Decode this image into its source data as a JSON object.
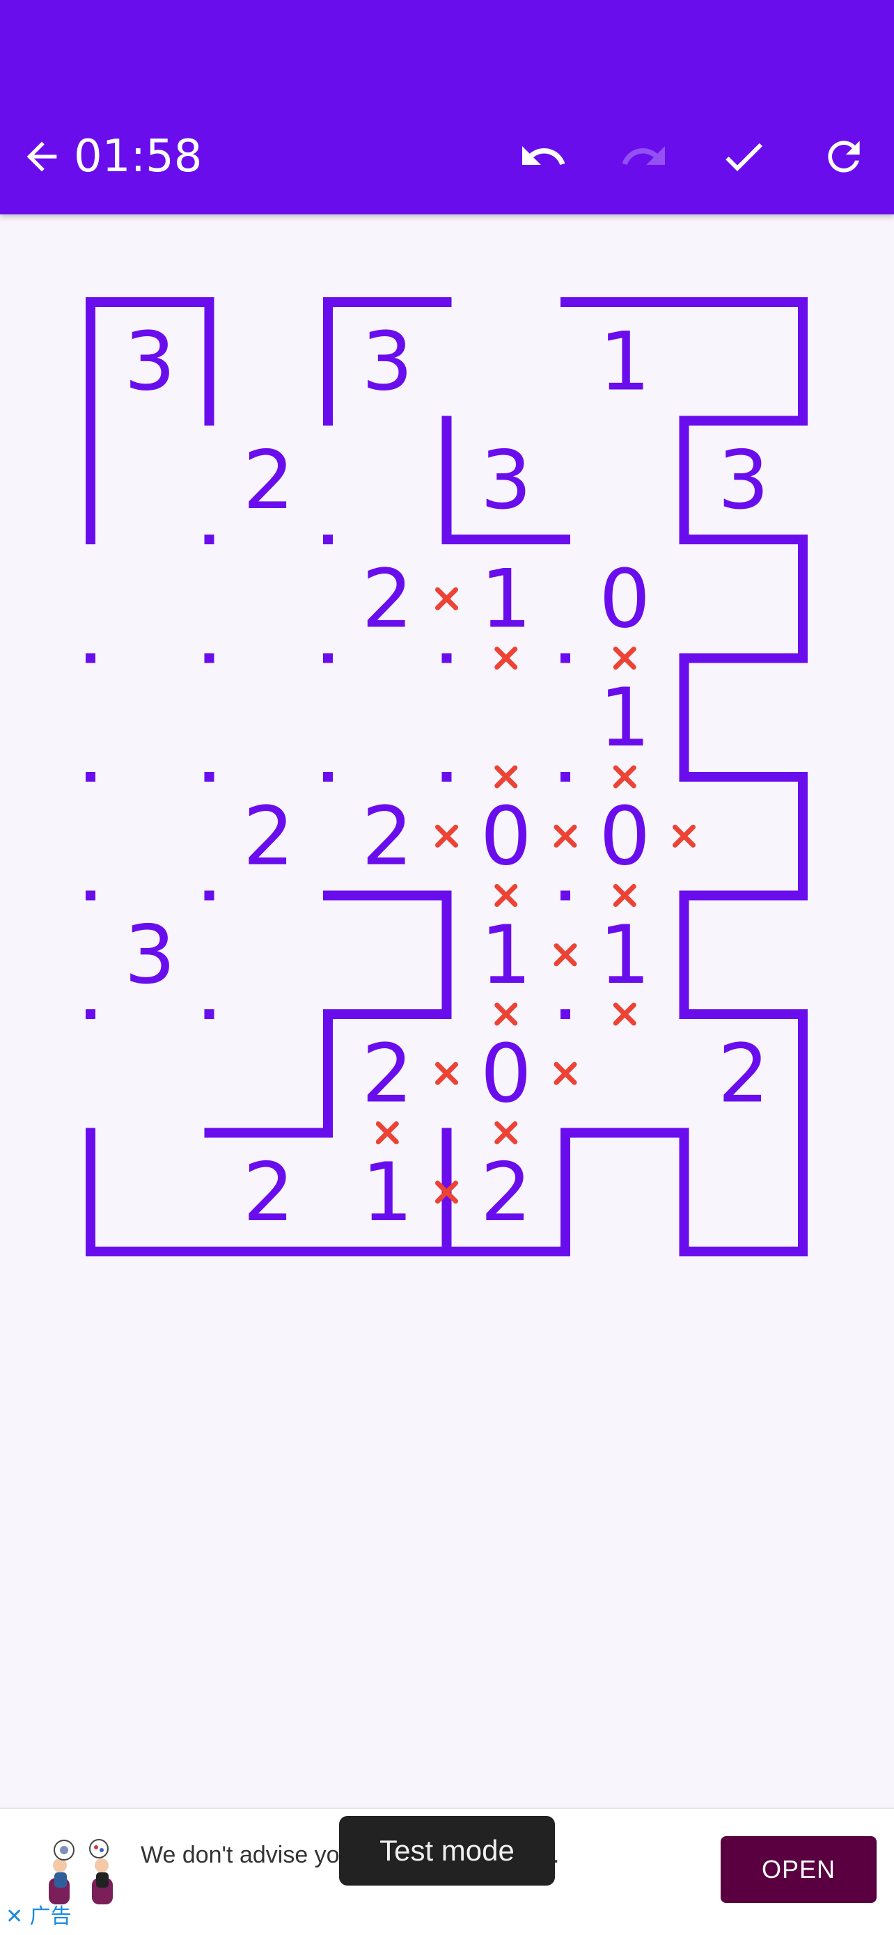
{
  "header": {
    "timer": "01:58",
    "icons": {
      "back": "arrow-back-icon",
      "undo": "undo-icon",
      "redo": "redo-icon",
      "check": "check-icon",
      "restart": "restart-icon"
    },
    "background_color": "#6a0ded"
  },
  "puzzle": {
    "rows": 8,
    "cols": 6,
    "line_color": "#6a0ded",
    "number_color": "#6a0ded",
    "cross_color": "#ec4334",
    "clues": [
      {
        "row": 0,
        "col": 0,
        "text": "3"
      },
      {
        "row": 0,
        "col": 2,
        "text": "3"
      },
      {
        "row": 0,
        "col": 4,
        "text": "1"
      },
      {
        "row": 1,
        "col": 1,
        "text": "2"
      },
      {
        "row": 1,
        "col": 3,
        "text": "3"
      },
      {
        "row": 1,
        "col": 5,
        "text": "3"
      },
      {
        "row": 2,
        "col": 2,
        "text": "2"
      },
      {
        "row": 2,
        "col": 3,
        "text": "1"
      },
      {
        "row": 2,
        "col": 4,
        "text": "0"
      },
      {
        "row": 3,
        "col": 4,
        "text": "1"
      },
      {
        "row": 4,
        "col": 1,
        "text": "2"
      },
      {
        "row": 4,
        "col": 2,
        "text": "2"
      },
      {
        "row": 4,
        "col": 3,
        "text": "0"
      },
      {
        "row": 4,
        "col": 4,
        "text": "0"
      },
      {
        "row": 5,
        "col": 0,
        "text": "3"
      },
      {
        "row": 5,
        "col": 3,
        "text": "1"
      },
      {
        "row": 5,
        "col": 4,
        "text": "1"
      },
      {
        "row": 6,
        "col": 2,
        "text": "2"
      },
      {
        "row": 6,
        "col": 3,
        "text": "0"
      },
      {
        "row": 6,
        "col": 5,
        "text": "2"
      },
      {
        "row": 7,
        "col": 1,
        "text": "2"
      },
      {
        "row": 7,
        "col": 2,
        "text": "1"
      },
      {
        "row": 7,
        "col": 3,
        "text": "2"
      }
    ],
    "h_lines": [
      [
        0,
        0
      ],
      [
        0,
        2
      ],
      [
        0,
        4
      ],
      [
        0,
        5
      ],
      [
        1,
        5
      ],
      [
        2,
        3
      ],
      [
        2,
        5
      ],
      [
        3,
        5
      ],
      [
        4,
        5
      ],
      [
        5,
        2
      ],
      [
        5,
        5
      ],
      [
        6,
        2
      ],
      [
        6,
        5
      ],
      [
        7,
        1
      ],
      [
        7,
        4
      ],
      [
        8,
        0
      ],
      [
        8,
        1
      ],
      [
        8,
        2
      ],
      [
        8,
        3
      ],
      [
        8,
        5
      ]
    ],
    "v_lines": [
      [
        0,
        0
      ],
      [
        0,
        1
      ],
      [
        0,
        2
      ],
      [
        0,
        6
      ],
      [
        1,
        0
      ],
      [
        1,
        3
      ],
      [
        1,
        5
      ],
      [
        2,
        6
      ],
      [
        3,
        5
      ],
      [
        4,
        6
      ],
      [
        5,
        3
      ],
      [
        5,
        5
      ],
      [
        6,
        2
      ],
      [
        6,
        6
      ],
      [
        7,
        0
      ],
      [
        7,
        3
      ],
      [
        7,
        4
      ],
      [
        7,
        5
      ],
      [
        7,
        6
      ]
    ],
    "v_crosses": [
      [
        2,
        3
      ],
      [
        4,
        3
      ],
      [
        4,
        4
      ],
      [
        4,
        5
      ],
      [
        5,
        4
      ],
      [
        6,
        3
      ],
      [
        6,
        4
      ],
      [
        7,
        3
      ]
    ],
    "h_crosses": [
      [
        3,
        3
      ],
      [
        3,
        4
      ],
      [
        4,
        3
      ],
      [
        4,
        4
      ],
      [
        5,
        3
      ],
      [
        5,
        4
      ],
      [
        6,
        3
      ],
      [
        6,
        4
      ],
      [
        7,
        2
      ],
      [
        7,
        3
      ]
    ],
    "dots": [
      [
        1,
        3
      ],
      [
        2,
        1
      ],
      [
        2,
        2
      ],
      [
        3,
        0
      ],
      [
        3,
        1
      ],
      [
        3,
        2
      ],
      [
        3,
        3
      ],
      [
        3,
        4
      ],
      [
        4,
        0
      ],
      [
        4,
        1
      ],
      [
        4,
        2
      ],
      [
        4,
        3
      ],
      [
        4,
        4
      ],
      [
        5,
        0
      ],
      [
        5,
        1
      ],
      [
        5,
        4
      ],
      [
        6,
        0
      ],
      [
        6,
        1
      ],
      [
        6,
        4
      ],
      [
        7,
        3
      ]
    ]
  },
  "ad": {
    "text": "We don't advise you and let you be you.",
    "button": "OPEN",
    "close_label": "✕ 广告",
    "button_color": "#5a0040"
  },
  "toast": {
    "text": "Test mode"
  }
}
